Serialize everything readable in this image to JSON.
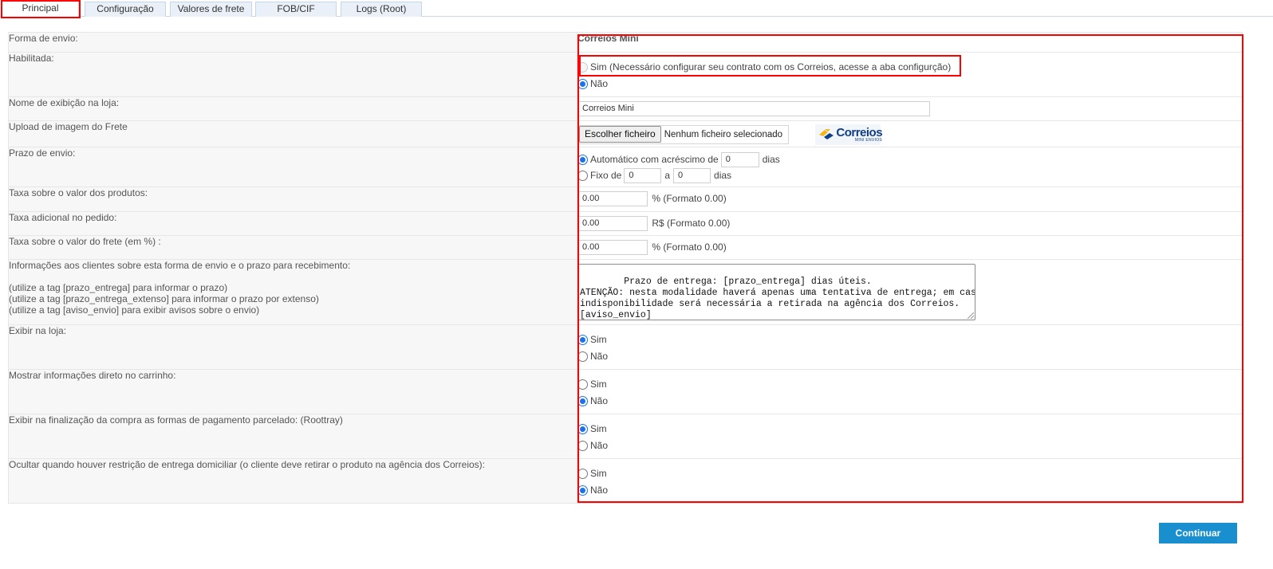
{
  "tabs": [
    {
      "label": "Principal"
    },
    {
      "label": "Configuração"
    },
    {
      "label": "Valores de frete"
    },
    {
      "label": "FOB/CIF"
    },
    {
      "label": "Logs (Root)"
    }
  ],
  "fields": {
    "forma_envio": {
      "label": "Forma de envio:",
      "value": "Correios Mini"
    },
    "habilitada": {
      "label": "Habilitada:",
      "option_sim": "Sim (Necessário configurar seu contrato com os Correios, acesse a aba configurção)",
      "option_nao": "Não",
      "selected": "Não"
    },
    "nome_exibicao": {
      "label": "Nome de exibição na loja:",
      "value": "Correios Mini"
    },
    "upload_imagem": {
      "label": "Upload de imagem do Frete",
      "button": "Escolher ficheiro",
      "status": "Nenhum ficheiro selecionado",
      "logo_text": "Correios",
      "logo_subtext": "MINI ENVIOS"
    },
    "prazo_envio": {
      "label": "Prazo de envio:",
      "auto_label": "Automático com acréscimo de",
      "auto_value": "0",
      "auto_unit": "dias",
      "fixo_label": "Fixo de",
      "fixo_from": "0",
      "fixo_sep": "a",
      "fixo_to": "0",
      "fixo_unit": "dias",
      "selected": "Automático"
    },
    "taxa_produtos": {
      "label": "Taxa sobre o valor dos produtos:",
      "value": "0.00",
      "hint": "% (Formato 0.00)"
    },
    "taxa_adicional": {
      "label": "Taxa adicional no pedido:",
      "value": "0.00",
      "hint": "R$ (Formato 0.00)"
    },
    "taxa_frete": {
      "label": "Taxa sobre o valor do frete (em %) :",
      "value": "0.00",
      "hint": "% (Formato 0.00)"
    },
    "informacoes": {
      "label": "Informações aos clientes sobre esta forma de envio e o prazo para recebimento:",
      "help1": "(utilize a tag [prazo_entrega] para informar o prazo)",
      "help2": "(utilize a tag [prazo_entrega_extenso] para informar o prazo por extenso)",
      "help3": "(utilize a tag [aviso_envio] para exibir avisos sobre o envio)",
      "text": "Prazo de entrega: [prazo_entrega] dias úteis.\nATENÇÃO: nesta modalidade haverá apenas uma tentativa de entrega; em caso de\nindisponibilidade será necessária a retirada na agência dos Correios.\n[aviso_envio]"
    },
    "exibir_loja": {
      "label": "Exibir na loja:",
      "option_sim": "Sim",
      "option_nao": "Não",
      "selected": "Sim"
    },
    "mostrar_carrinho": {
      "label": "Mostrar informações direto no carrinho:",
      "option_sim": "Sim",
      "option_nao": "Não",
      "selected": "Não"
    },
    "exibir_parcelado": {
      "label": "Exibir na finalização da compra as formas de pagamento parcelado: (Roottray)",
      "option_sim": "Sim",
      "option_nao": "Não",
      "selected": "Sim"
    },
    "ocultar_restricao": {
      "label": "Ocultar quando houver restrição de entrega domiciliar (o cliente deve retirar o produto na agência dos Correios):",
      "option_sim": "Sim",
      "option_nao": "Não",
      "selected": "Não"
    }
  },
  "actions": {
    "continuar": "Continuar"
  },
  "colors": {
    "highlight": "#ff0000",
    "primary_button": "#1a8fd0",
    "tab_bg": "#e9f0f7",
    "radio_checked": "#1a73e8"
  }
}
